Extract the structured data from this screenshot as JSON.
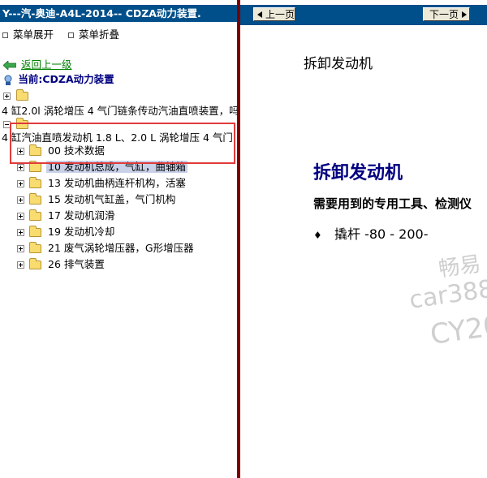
{
  "left_pane": {
    "title": "Y---汽-奥迪-A4L-2014-- CDZA动力装置.",
    "menu": {
      "expand_label": "菜单展开",
      "collapse_label": "菜单折叠"
    },
    "back_link": "返回上一级",
    "current_label": "当前:CDZA动力装置",
    "tree": {
      "node1_text": "4 缸2.0l 涡轮增压 4 气门链条传动汽油直喷装置，吗",
      "node2_text": "4 缸汽油直喷发动机 1.8 L、2.0 L 涡轮增压 4 气门",
      "children": [
        "00 技术数据",
        "10 发动机总成，气缸，曲轴箱",
        "13 发动机曲柄连杆机构，活塞",
        "15 发动机气缸盖，气门机构",
        "17 发动机润滑",
        "19 发动机冷却",
        "21 废气涡轮增压器，G形增压器",
        "26 排气装置"
      ]
    }
  },
  "right_pane": {
    "prev_label": "上一页",
    "next_label": "下一页",
    "page_heading": "拆卸发动机",
    "main_title": "拆卸发动机",
    "tools_line": "需要用到的专用工具、检测仪",
    "tool_bullet": "♦",
    "tool_item": "撬杆 -80 - 200-",
    "watermarks": [
      "畅易",
      "car388.",
      "CY20"
    ]
  },
  "colors": {
    "title_bar": "#004f8a",
    "divider": "#7a0000",
    "highlight_box": "#e03a3a",
    "heading_blue": "#000080",
    "selected_bg": "#c9d1e8",
    "link_green": "#008000"
  }
}
